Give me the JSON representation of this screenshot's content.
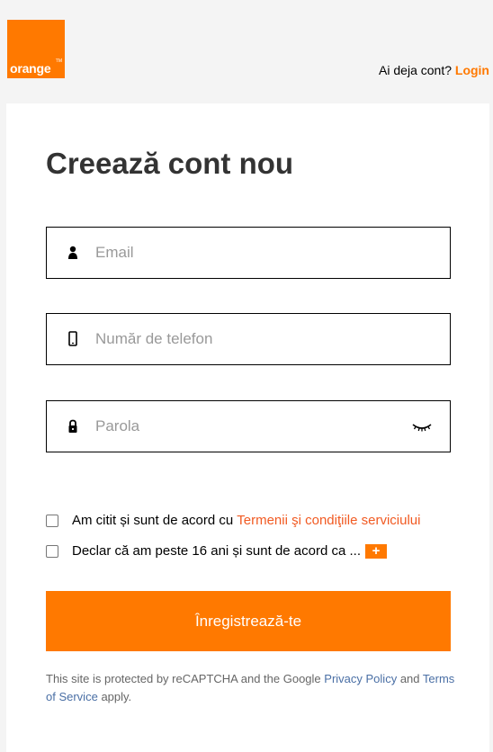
{
  "header": {
    "logo_text": "orange",
    "logo_tm": "TM",
    "login_prompt": "Ai deja cont?",
    "login_link": "Login"
  },
  "form": {
    "title": "Creează cont nou",
    "email_placeholder": "Email",
    "phone_placeholder": "Număr de telefon",
    "password_placeholder": "Parola",
    "terms_checkbox_text": "Am citit și sunt de acord cu",
    "terms_link": "Termenii şi condiţiile serviciului",
    "age_checkbox_text": "Declar că am peste 16 ani și sunt de acord ca ...",
    "expand_label": "+",
    "submit_label": "Înregistrează-te"
  },
  "recaptcha": {
    "text_1": "This site is protected by reCAPTCHA and the Google",
    "privacy_link": "Privacy Policy",
    "text_2": "and",
    "terms_link": "Terms of Service",
    "text_3": "apply."
  },
  "colors": {
    "brand_orange": "#ff7900",
    "link_red": "#f15a22",
    "link_blue": "#4a6fa5"
  },
  "icons": {
    "email": "person-icon",
    "phone": "phone-icon",
    "password": "lock-icon",
    "toggle": "eye-closed-icon"
  }
}
